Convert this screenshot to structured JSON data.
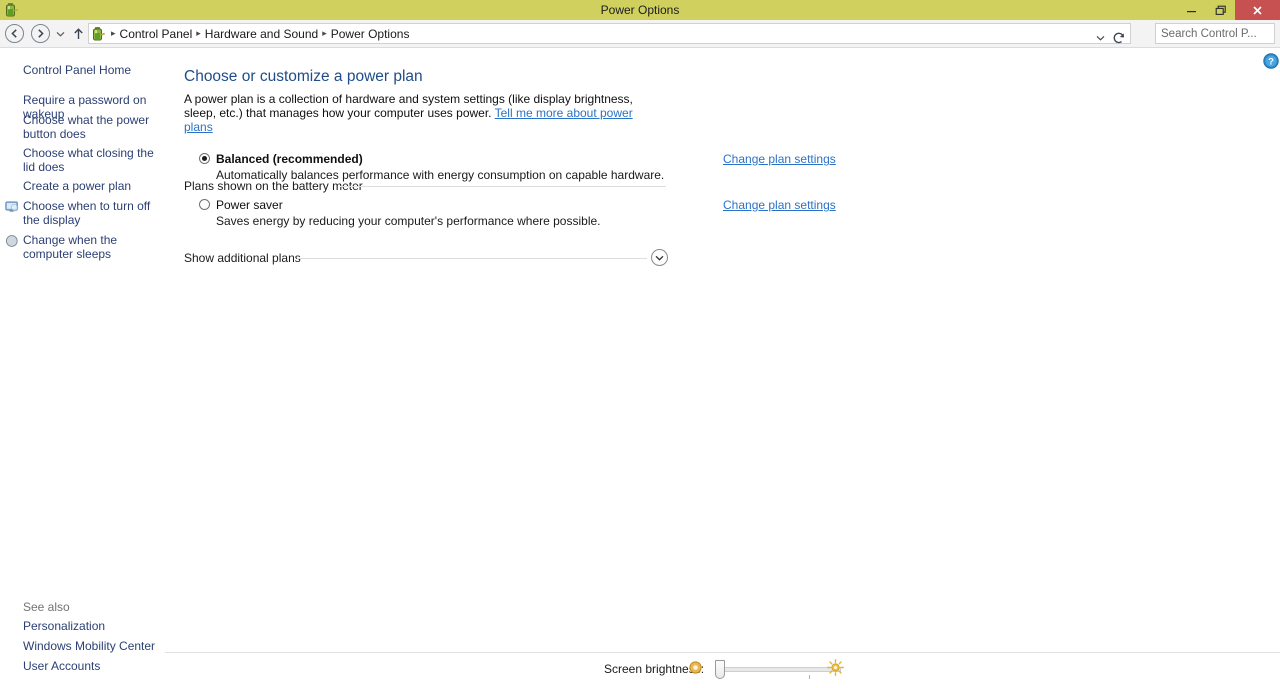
{
  "window": {
    "title": "Power Options",
    "icon": "battery-icon",
    "minimize_label": "—",
    "restore_label": "❐",
    "close_label": "×"
  },
  "nav": {
    "back_label": "←",
    "forward_label": "→",
    "history_label": "⌄",
    "up_label": "↑",
    "chevron_label": "⌄",
    "refresh_label": "↻",
    "breadcrumbs": [
      "Control Panel",
      "Hardware and Sound",
      "Power Options"
    ],
    "separator": "▸"
  },
  "search": {
    "placeholder": "Search Control P...",
    "value": "",
    "icon": "search-icon"
  },
  "sidebar": {
    "home_label": "Control Panel Home",
    "items": [
      {
        "label": "Require a password on wakeup",
        "icon": null
      },
      {
        "label": "Choose what the power button does",
        "icon": null
      },
      {
        "label": "Choose what closing the lid does",
        "icon": null
      },
      {
        "label": "Create a power plan",
        "icon": null
      },
      {
        "label": "Choose when to turn off the display",
        "icon": "monitor-icon"
      },
      {
        "label": "Change when the computer sleeps",
        "icon": "moon-icon"
      }
    ],
    "see_also_label": "See also",
    "see_also_items": [
      "Personalization",
      "Windows Mobility Center",
      "User Accounts"
    ]
  },
  "main": {
    "help_label": "?",
    "title": "Choose or customize a power plan",
    "description_part1": "A power plan is a collection of hardware and system settings (like display brightness, sleep, etc.) that manages how your computer uses power. ",
    "description_link": "Tell me more about power plans",
    "group_heading": "Plans shown on the battery meter",
    "plans": [
      {
        "name": "Balanced (recommended)",
        "description": "Automatically balances performance with energy consumption on capable hardware.",
        "selected": true,
        "link_label": "Change plan settings"
      },
      {
        "name": "Power saver",
        "description": "Saves energy by reducing your computer's performance where possible.",
        "selected": false,
        "link_label": "Change plan settings"
      }
    ],
    "additional_plans_label": "Show additional plans",
    "expander_icon": "chevron-down-icon"
  },
  "brightness": {
    "label": "Screen brightness:",
    "dim_icon": "sun-dim-icon",
    "full_icon": "sun-bright-icon",
    "value_percent": 4
  },
  "colors": {
    "titlebar": "#cfd05e",
    "close_button": "#c75050",
    "link": "#2a72c8",
    "sidebar_link": "#2b3f73",
    "heading": "#204d89",
    "accent_sun": "#d79a27"
  }
}
